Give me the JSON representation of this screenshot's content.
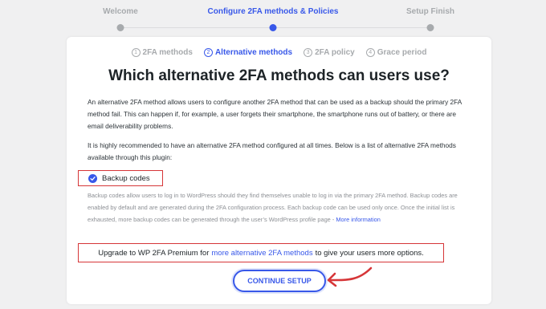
{
  "wizard": {
    "steps": [
      {
        "label": "Welcome"
      },
      {
        "label": "Configure 2FA methods & Policies"
      },
      {
        "label": "Setup Finish"
      }
    ]
  },
  "substeps": [
    {
      "num": "1",
      "label": "2FA methods"
    },
    {
      "num": "2",
      "label": "Alternative methods"
    },
    {
      "num": "3",
      "label": "2FA policy"
    },
    {
      "num": "4",
      "label": "Grace period"
    }
  ],
  "main": {
    "heading": "Which alternative 2FA methods can users use?",
    "intro": "An alternative 2FA method allows users to configure another 2FA method that can be used as a backup should the primary 2FA method fail. This can happen if, for example, a user forgets their smartphone, the smartphone runs out of battery, or there are email deliverability problems.",
    "recommend": "It is highly recommended to have an alternative 2FA method configured at all times. Below is a list of alternative 2FA methods available through this plugin:",
    "option_label": "Backup codes",
    "option_desc": "Backup codes allow users to log in to WordPress should they find themselves unable to log in via the primary 2FA method. Backup codes are enabled by default and are generated during the 2FA configuration process. Each backup code can be used only once. Once the initial list is exhausted, more backup codes can be generated through the user’s WordPress profile page -",
    "more_info": "More information",
    "upgrade_prefix": "Upgrade to WP 2FA Premium for",
    "upgrade_link": "more alternative 2FA methods",
    "upgrade_suffix": "to give your users more options.",
    "button": "CONTINUE SETUP"
  },
  "colors": {
    "accent": "#3858e9",
    "highlight": "#d63638"
  }
}
